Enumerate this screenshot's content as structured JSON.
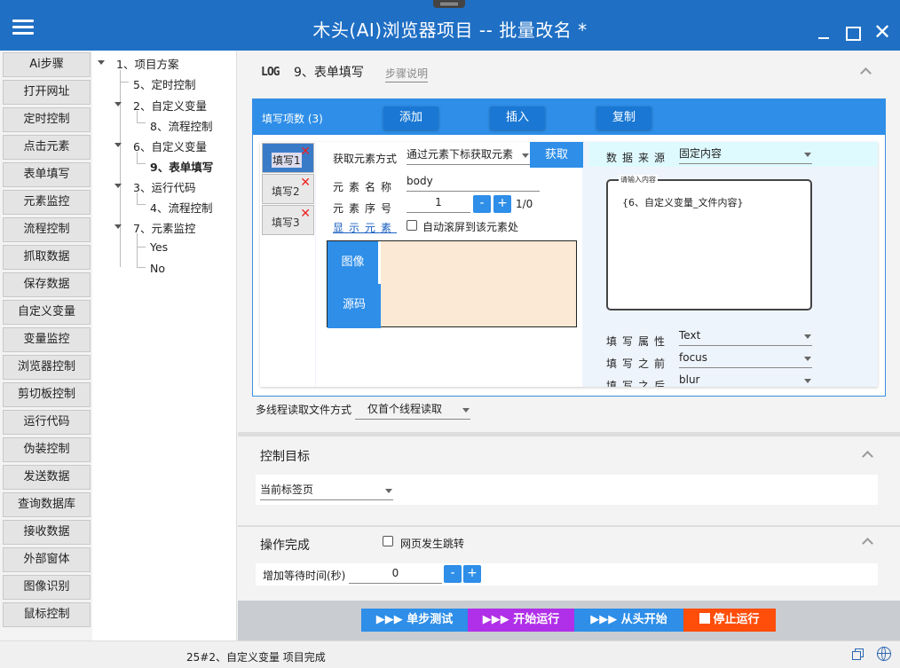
{
  "window": {
    "title": "木头(AI)浏览器项目  --   批量改名 *"
  },
  "sidebar": {
    "items": [
      "Ai步骤",
      "打开网址",
      "定时控制",
      "点击元素",
      "表单填写",
      "元素监控",
      "流程控制",
      "抓取数据",
      "保存数据",
      "自定义变量",
      "变量监控",
      "浏览器控制",
      "剪切板控制",
      "运行代码",
      "伪装控制",
      "发送数据",
      "查询数据库",
      "接收数据",
      "外部窗体",
      "图像识别",
      "鼠标控制"
    ]
  },
  "tree": {
    "nodes": [
      {
        "label": "1、项目方案"
      },
      {
        "label": "5、定时控制"
      },
      {
        "label": "2、自定义变量"
      },
      {
        "label": "8、流程控制"
      },
      {
        "label": "6、自定义变量"
      },
      {
        "label": "9、表单填写"
      },
      {
        "label": "3、运行代码"
      },
      {
        "label": "4、流程控制"
      },
      {
        "label": "7、元素监控"
      },
      {
        "label": "Yes"
      },
      {
        "label": "No"
      }
    ]
  },
  "step": {
    "log_icon": "LOG",
    "title": "9、表单填写",
    "desc_link": "步骤说明"
  },
  "fill": {
    "count_label": "填写项数 (3)",
    "add": "添加",
    "insert": "插入",
    "copy": "复制",
    "tabs": [
      "填写1",
      "填写2",
      "填写3"
    ],
    "close_glyph": "✕",
    "method_label": "获取元素方式",
    "method_value": "通过元素下标获取元素",
    "get_button": "获取",
    "name_label": "元素名称",
    "name_value": "body",
    "index_label": "元素序号",
    "index_value": "1",
    "minus": "-",
    "plus": "+",
    "index_total": "1/0",
    "show_element": "显示元素",
    "auto_scroll": "自动滚屏到该元素处",
    "image_tab": "图像",
    "source_tab": "源码",
    "source_label": "数据来源",
    "source_value": "固定内容",
    "input_legend": "请输入内容",
    "input_content": "{6、自定义变量_文件内容}",
    "attr_label": "填写属性",
    "attr_value": "Text",
    "before_label": "填写之前",
    "before_value": "focus",
    "after_label": "填写之后",
    "after_value": "blur"
  },
  "multithread": {
    "label": "多线程读取文件方式",
    "value": "仅首个线程读取"
  },
  "control_target": {
    "title": "控制目标",
    "value": "当前标签页"
  },
  "complete": {
    "title": "操作完成",
    "page_jump": "网页发生跳转",
    "wait_label": "增加等待时间(秒)",
    "wait_value": "0",
    "minus": "-",
    "plus": "+"
  },
  "actions": {
    "step_test": "▶▶▶ 单步测试",
    "start": "▶▶▶ 开始运行",
    "from_start": "▶▶▶ 从头开始",
    "stop": "停止运行",
    "colors": {
      "step_test": "#2e8ee8",
      "start": "#b02fe8",
      "from_start": "#2e8ee8",
      "stop": "#ff4d0a"
    }
  },
  "status": {
    "text": "25#2、自定义变量 项目完成"
  },
  "colors": {
    "titlebar": "#1f6fc4",
    "accent": "#2e8ee8"
  }
}
